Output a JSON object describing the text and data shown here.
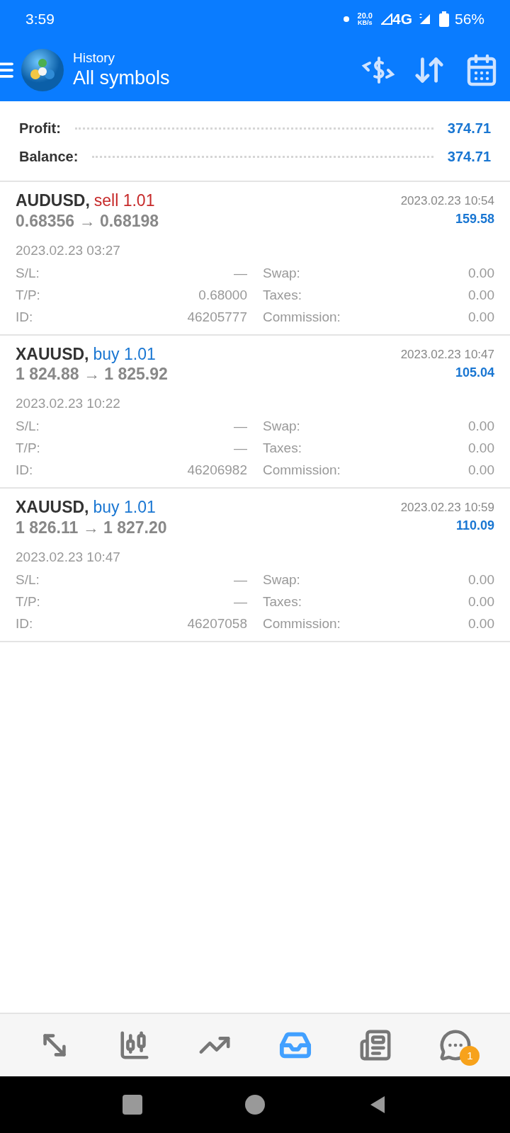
{
  "status_bar": {
    "time": "3:59",
    "speed": "20.0",
    "speed_unit": "KB/s",
    "network": "4G",
    "battery": "56%"
  },
  "header": {
    "subtitle": "History",
    "title": "All symbols"
  },
  "summary": [
    {
      "label": "Profit:",
      "value": "374.71"
    },
    {
      "label": "Balance:",
      "value": "374.71"
    }
  ],
  "deals": [
    {
      "symbol": "AUDUSD,",
      "kind": "sell",
      "order": "sell 1.01",
      "prices": "0.68356 → 0.68198",
      "close_time": "2023.02.23 10:54",
      "profit": "159.58",
      "open_time": "2023.02.23 03:27",
      "left": [
        {
          "label": "S/L:",
          "value": "—"
        },
        {
          "label": "T/P:",
          "value": "0.68000"
        },
        {
          "label": "ID:",
          "value": "46205777"
        }
      ],
      "right": [
        {
          "label": "Swap:",
          "value": "0.00"
        },
        {
          "label": "Taxes:",
          "value": "0.00"
        },
        {
          "label": "Commission:",
          "value": "0.00"
        }
      ]
    },
    {
      "symbol": "XAUUSD,",
      "kind": "buy",
      "order": "buy 1.01",
      "prices": "1 824.88 → 1 825.92",
      "close_time": "2023.02.23 10:47",
      "profit": "105.04",
      "open_time": "2023.02.23 10:22",
      "left": [
        {
          "label": "S/L:",
          "value": "—"
        },
        {
          "label": "T/P:",
          "value": "—"
        },
        {
          "label": "ID:",
          "value": "46206982"
        }
      ],
      "right": [
        {
          "label": "Swap:",
          "value": "0.00"
        },
        {
          "label": "Taxes:",
          "value": "0.00"
        },
        {
          "label": "Commission:",
          "value": "0.00"
        }
      ]
    },
    {
      "symbol": "XAUUSD,",
      "kind": "buy",
      "order": "buy 1.01",
      "prices": "1 826.11 → 1 827.20",
      "close_time": "2023.02.23 10:59",
      "profit": "110.09",
      "open_time": "2023.02.23 10:47",
      "left": [
        {
          "label": "S/L:",
          "value": "—"
        },
        {
          "label": "T/P:",
          "value": "—"
        },
        {
          "label": "ID:",
          "value": "46207058"
        }
      ],
      "right": [
        {
          "label": "Swap:",
          "value": "0.00"
        },
        {
          "label": "Taxes:",
          "value": "0.00"
        },
        {
          "label": "Commission:",
          "value": "0.00"
        }
      ]
    }
  ],
  "bottom_nav": [
    {
      "kind": "quotes",
      "selected": false
    },
    {
      "kind": "chart",
      "selected": false
    },
    {
      "kind": "trade",
      "selected": false
    },
    {
      "kind": "history",
      "selected": true
    },
    {
      "kind": "news",
      "selected": false
    },
    {
      "kind": "messages",
      "selected": false,
      "badge": "1"
    }
  ]
}
